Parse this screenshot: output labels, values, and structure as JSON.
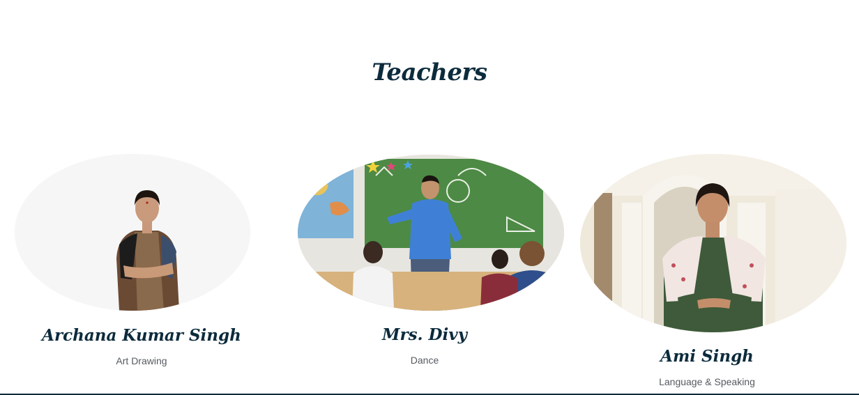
{
  "section": {
    "title": "Teachers"
  },
  "teachers": [
    {
      "name": "Archana Kumar Singh",
      "subject": "Art Drawing",
      "photo_icon": "teacher-portrait-woman-saree"
    },
    {
      "name": "Mrs. Divy",
      "subject": "Dance",
      "photo_icon": "teacher-classroom-chalkboard"
    },
    {
      "name": "Ami Singh",
      "subject": "Language & Speaking",
      "photo_icon": "teacher-portrait-woman-arches"
    }
  ],
  "colors": {
    "heading": "#0c2b3c",
    "subtext": "#555a60",
    "background": "#ffffff"
  }
}
